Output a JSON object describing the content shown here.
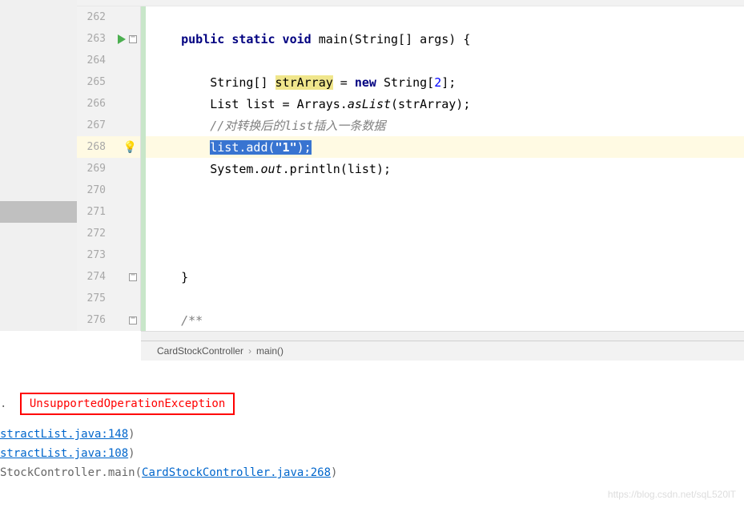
{
  "lines": {
    "262": {
      "number": "262"
    },
    "263": {
      "number": "263",
      "code_prefix": "    ",
      "kw": "public static void",
      "method": " main(String[] args) {"
    },
    "264": {
      "number": "264"
    },
    "265": {
      "number": "265",
      "indent": "        String[] ",
      "hl": "strArray",
      "mid": " = ",
      "new": "new",
      "tail": " String[",
      "num": "2",
      "end": "];"
    },
    "266": {
      "number": "266",
      "text": "        List list = Arrays.",
      "aslist": "asList",
      "tail": "(strArray);"
    },
    "267": {
      "number": "267",
      "indent": "        ",
      "comment": "//对转换后的list插入一条数据"
    },
    "268": {
      "number": "268",
      "indent": "        ",
      "sel_pre": "list.add(",
      "sel_str": "\"1\"",
      "sel_end": ");"
    },
    "269": {
      "number": "269",
      "indent": "        System.",
      "out": "out",
      "tail": ".println(list);"
    },
    "270": {
      "number": "270"
    },
    "271": {
      "number": "271"
    },
    "272": {
      "number": "272"
    },
    "273": {
      "number": "273"
    },
    "274": {
      "number": "274",
      "brace": "    }"
    },
    "275": {
      "number": "275"
    },
    "276": {
      "number": "276",
      "indent": "    ",
      "comment": "/**"
    }
  },
  "breadcrumb": {
    "class": "CardStockController",
    "method": "main()"
  },
  "console": {
    "exception": "UnsupportedOperationException",
    "trace1": "stractList.java:148",
    "trace2": "stractList.java:108",
    "trace3_pre": "StockController.main(",
    "trace3_link": "CardStockController.java:268",
    "trace3_end": ")"
  },
  "watermark": "https://blog.csdn.net/sqL520lT"
}
